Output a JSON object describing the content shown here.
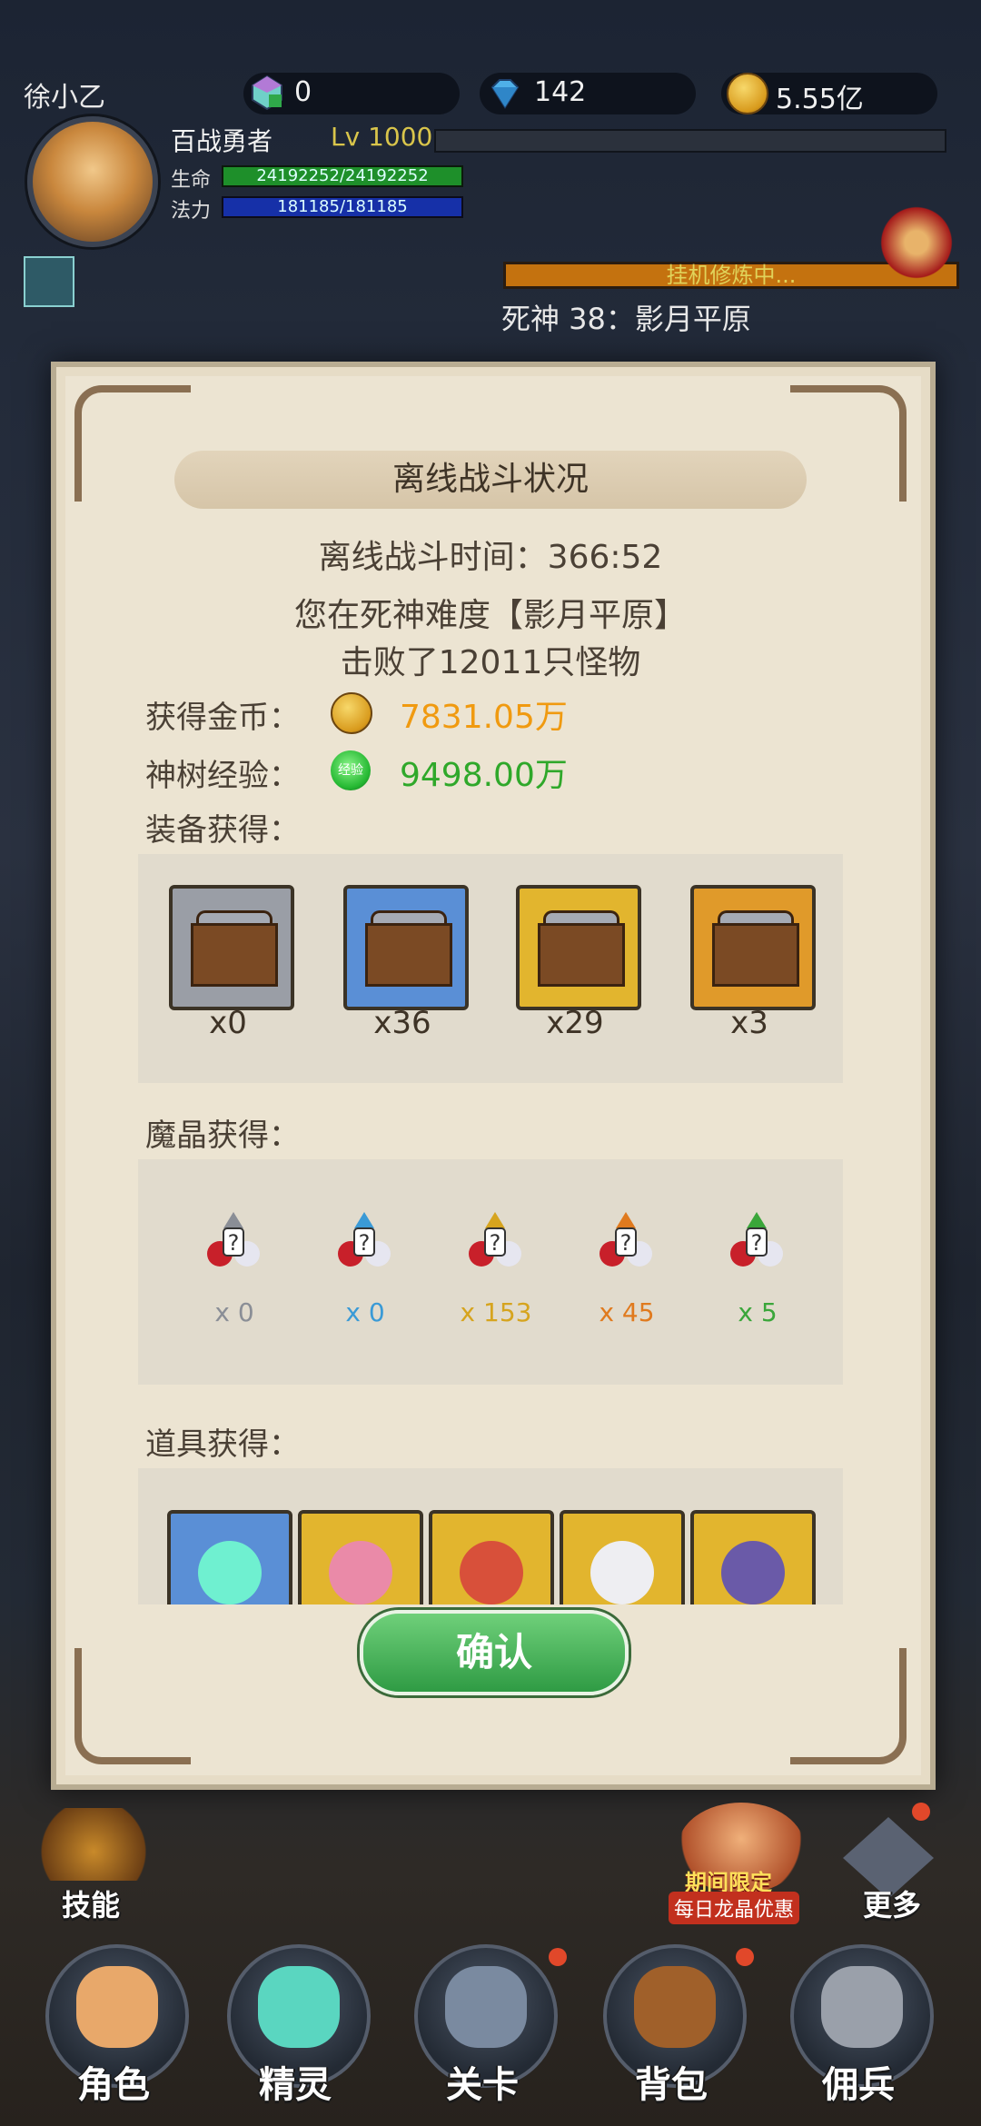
{
  "player": {
    "name": "徐小乙",
    "title": "百战勇者",
    "level": "Lv 1000",
    "hp_label": "生命",
    "hp": "24192252/24192252",
    "mp_label": "法力",
    "mp": "181185/181185"
  },
  "currencies": {
    "crystal": "0",
    "diamond": "142",
    "gold": "5.55亿"
  },
  "idle": {
    "status": "挂机修炼中...",
    "stage": "死神 38：影月平原"
  },
  "dialog": {
    "title": "离线战斗状况",
    "time_text": "离线战斗时间：366:52",
    "difficulty_text": "您在死神难度【影月平原】",
    "kills_text": "击败了12011只怪物",
    "gold_label": "获得金币：",
    "gold_value": "7831.05万",
    "exp_label": "神树经验：",
    "exp_icon_text": "经验",
    "exp_value": "9498.00万",
    "equip_label": "装备获得：",
    "equip": [
      {
        "count": "x0",
        "color": "#9a9ea6"
      },
      {
        "count": "x36",
        "color": "#5a8fd6"
      },
      {
        "count": "x29",
        "color": "#e2b52e"
      },
      {
        "count": "x3",
        "color": "#e09a2a"
      }
    ],
    "crystal_label": "魔晶获得：",
    "crystals": [
      {
        "count": "x 0",
        "color": "#8a8e96"
      },
      {
        "count": "x 0",
        "color": "#3a9ad6"
      },
      {
        "count": "x 153",
        "color": "#d6a41e"
      },
      {
        "count": "x 45",
        "color": "#e07a1e"
      },
      {
        "count": "x 5",
        "color": "#3aa63a"
      }
    ],
    "item_label": "道具获得：",
    "items": [
      {
        "name": "green-flame-flower-icon",
        "frame": "#5a8fd6"
      },
      {
        "name": "pink-shuriken-icon",
        "frame": "#e2b52e"
      },
      {
        "name": "red-swirl-icon",
        "frame": "#e2b52e"
      },
      {
        "name": "white-orb-icon",
        "frame": "#e2b52e"
      },
      {
        "name": "purple-horn-icon",
        "frame": "#e2b52e"
      }
    ],
    "confirm": "确认"
  },
  "bottom": {
    "skill": "技能",
    "promo_line1": "期间限定",
    "promo_line2": "每日龙晶优惠",
    "more": "更多",
    "nav": [
      "角色",
      "精灵",
      "关卡",
      "背包",
      "佣兵"
    ]
  }
}
